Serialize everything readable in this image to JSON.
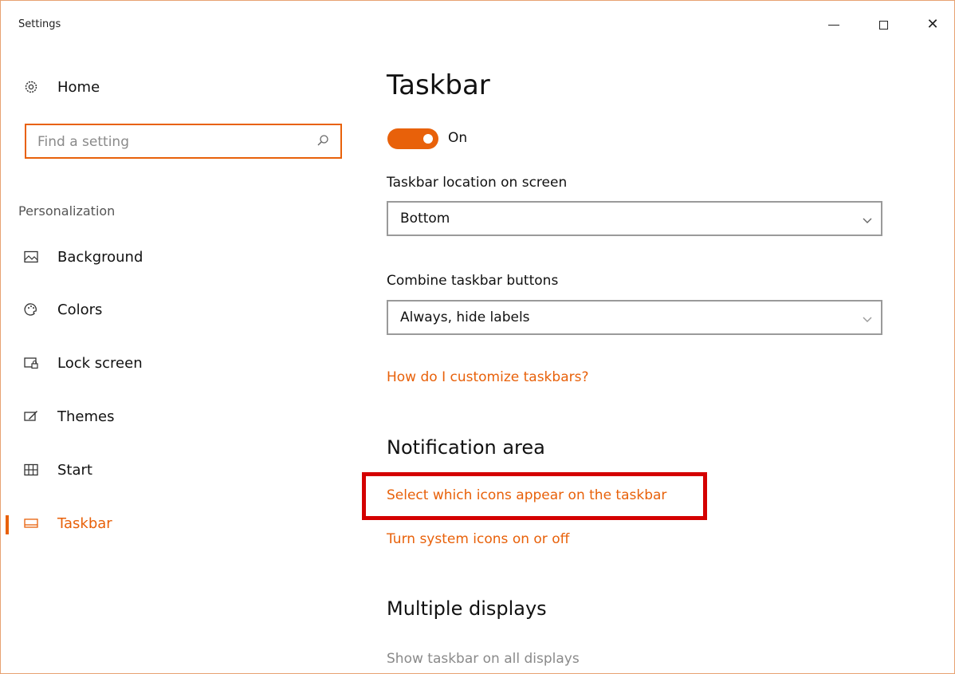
{
  "window": {
    "title": "Settings"
  },
  "sidebar": {
    "home_label": "Home",
    "search": {
      "placeholder": "Find a setting",
      "value": ""
    },
    "section_label": "Personalization",
    "items": [
      {
        "label": "Background",
        "icon": "picture-icon"
      },
      {
        "label": "Colors",
        "icon": "palette-icon"
      },
      {
        "label": "Lock screen",
        "icon": "lock-screen-icon"
      },
      {
        "label": "Themes",
        "icon": "themes-icon"
      },
      {
        "label": "Start",
        "icon": "start-icon"
      },
      {
        "label": "Taskbar",
        "icon": "taskbar-icon",
        "active": true
      }
    ]
  },
  "main": {
    "title": "Taskbar",
    "toggle": {
      "state_label": "On",
      "on": true
    },
    "location": {
      "label": "Taskbar location on screen",
      "selected": "Bottom"
    },
    "combine": {
      "label": "Combine taskbar buttons",
      "selected": "Always, hide labels"
    },
    "help_link": "How do I customize taskbars?",
    "notification_area": {
      "heading": "Notification area",
      "select_icons_link": "Select which icons appear on the taskbar",
      "system_icons_link": "Turn system icons on or off"
    },
    "multiple_displays": {
      "heading": "Multiple displays",
      "show_on_all_label": "Show taskbar on all displays"
    }
  },
  "colors": {
    "accent": "#e8610a",
    "highlight": "#d40000"
  }
}
